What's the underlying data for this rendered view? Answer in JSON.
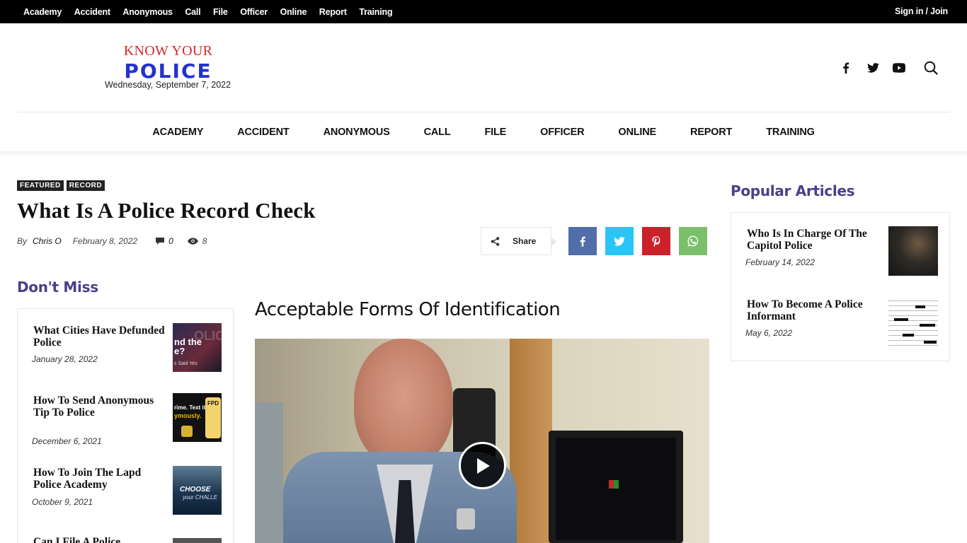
{
  "topbar": {
    "menu": [
      "Academy",
      "Accident",
      "Anonymous",
      "Call",
      "File",
      "Officer",
      "Online",
      "Report",
      "Training"
    ],
    "signin": "Sign in / Join"
  },
  "header": {
    "logo_line1": "KNOW YOUR",
    "logo_line2": "POLICE",
    "date": "Wednesday, September 7, 2022",
    "social_icons": [
      "facebook-icon",
      "twitter-icon",
      "youtube-icon"
    ],
    "search_icon": "search-icon"
  },
  "mainnav": [
    "ACADEMY",
    "ACCIDENT",
    "ANONYMOUS",
    "CALL",
    "FILE",
    "OFFICER",
    "ONLINE",
    "REPORT",
    "TRAINING"
  ],
  "article": {
    "tags": [
      "FEATURED",
      "RECORD"
    ],
    "title": "What Is A Police Record Check",
    "by": "By",
    "author": "Chris O",
    "date": "February 8, 2022",
    "comments": "0",
    "views": "8",
    "share_label": "Share",
    "share_buttons": [
      {
        "name": "facebook",
        "color": "#516eab"
      },
      {
        "name": "twitter",
        "color": "#29c5f6"
      },
      {
        "name": "pinterest",
        "color": "#ca212a"
      },
      {
        "name": "whatsapp",
        "color": "#7bbf6a"
      }
    ],
    "subheading": "Acceptable Forms Of Identification"
  },
  "dont_miss": {
    "title": "Don't Miss",
    "items": [
      {
        "title": "What Cities Have Defunded Police",
        "date": "January 28, 2022",
        "thumb_text": "nd the\ne?\ns Said Yes"
      },
      {
        "title": "How To Send Anonymous Tip To Police",
        "date": "December 6, 2021",
        "thumb_text": "rime. Text it.\nymously."
      },
      {
        "title": "How To Join The Lapd Police Academy",
        "date": "October 9, 2021",
        "thumb_text": "CHOOSE\nyour CHALLE"
      },
      {
        "title": "Can I File A Police",
        "date": "",
        "thumb_text": ""
      }
    ]
  },
  "popular": {
    "title": "Popular Articles",
    "items": [
      {
        "title": "Who Is In Charge Of The Capitol Police",
        "date": "February 14, 2022"
      },
      {
        "title": "How To Become A Police Informant",
        "date": "May 6, 2022"
      }
    ]
  },
  "colors": {
    "accent": "#4a3f8a",
    "logo_red": "#d42a2a",
    "logo_blue": "#2233cc"
  }
}
